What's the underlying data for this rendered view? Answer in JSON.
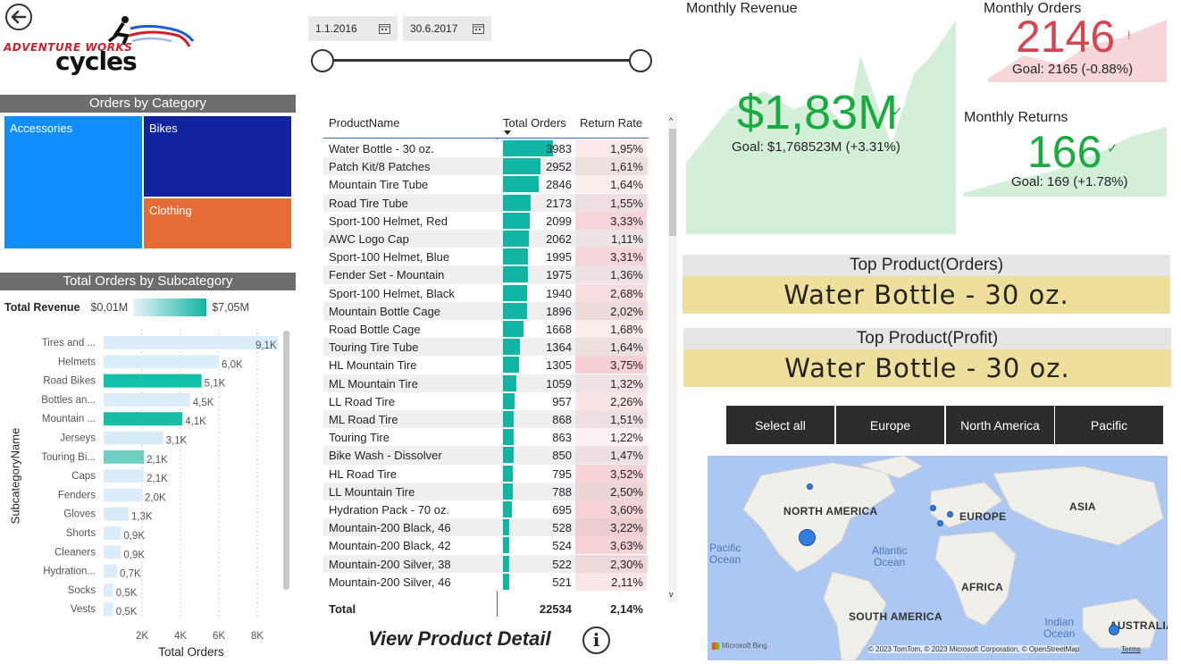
{
  "logo": {
    "line1": "ADVENTURE WORKS",
    "line2": "cycles"
  },
  "dates": {
    "start": "1.1.2016",
    "end": "30.6.2017"
  },
  "treemap": {
    "title": "Orders by Category",
    "items": [
      {
        "label": "Accessories",
        "color": "#118dff"
      },
      {
        "label": "Bikes",
        "color": "#12239e"
      },
      {
        "label": "Clothing",
        "color": "#e66c37"
      }
    ]
  },
  "subcategory": {
    "title": "Total Orders by Subcategory",
    "legend_label": "Total Revenue",
    "legend_min": "$0,01M",
    "legend_max": "$7,05M",
    "ylabel": "SubcategoryName",
    "xlabel": "Total Orders",
    "ticks": [
      "2K",
      "4K",
      "6K",
      "8K"
    ],
    "rows": [
      {
        "name": "Tires and ...",
        "value": 9.1,
        "label": "9,1K",
        "color": "#dbedfb"
      },
      {
        "name": "Helmets",
        "value": 6.0,
        "label": "6,0K",
        "color": "#d8eefa"
      },
      {
        "name": "Road Bikes",
        "value": 5.1,
        "label": "5,1K",
        "color": "#13c0a8"
      },
      {
        "name": "Bottles an...",
        "value": 4.5,
        "label": "4,5K",
        "color": "#dcedfa"
      },
      {
        "name": "Mountain ...",
        "value": 4.1,
        "label": "4,1K",
        "color": "#17bda5"
      },
      {
        "name": "Jerseys",
        "value": 3.1,
        "label": "3,1K",
        "color": "#d8ecf8"
      },
      {
        "name": "Touring Bi...",
        "value": 2.1,
        "label": "2,1K",
        "color": "#6dd0c2"
      },
      {
        "name": "Caps",
        "value": 2.1,
        "label": "2,1K",
        "color": "#dbedfb"
      },
      {
        "name": "Fenders",
        "value": 2.0,
        "label": "2,0K",
        "color": "#dbedfb"
      },
      {
        "name": "Gloves",
        "value": 1.3,
        "label": "1,3K",
        "color": "#d8ecf8"
      },
      {
        "name": "Shorts",
        "value": 0.9,
        "label": "0,9K",
        "color": "#dbedfb"
      },
      {
        "name": "Cleaners",
        "value": 0.9,
        "label": "0,9K",
        "color": "#dbedfb"
      },
      {
        "name": "Hydration...",
        "value": 0.7,
        "label": "0,7K",
        "color": "#dbedfb"
      },
      {
        "name": "Socks",
        "value": 0.5,
        "label": "0,5K",
        "color": "#dbedfb"
      },
      {
        "name": "Vests",
        "value": 0.5,
        "label": "0,5K",
        "color": "#dbedfb"
      }
    ]
  },
  "table": {
    "headers": [
      "ProductName",
      "Total Orders",
      "Return Rate"
    ],
    "rows": [
      {
        "name": "Water Bottle - 30 oz.",
        "orders": 3983,
        "orders_label": "3983",
        "rate": "1,95%"
      },
      {
        "name": "Patch Kit/8 Patches",
        "orders": 2952,
        "orders_label": "2952",
        "rate": "1,61%"
      },
      {
        "name": "Mountain Tire Tube",
        "orders": 2846,
        "orders_label": "2846",
        "rate": "1,64%"
      },
      {
        "name": "Road Tire Tube",
        "orders": 2173,
        "orders_label": "2173",
        "rate": "1,55%"
      },
      {
        "name": "Sport-100 Helmet, Red",
        "orders": 2099,
        "orders_label": "2099",
        "rate": "3,33%"
      },
      {
        "name": "AWC Logo Cap",
        "orders": 2062,
        "orders_label": "2062",
        "rate": "1,11%"
      },
      {
        "name": "Sport-100 Helmet, Blue",
        "orders": 1995,
        "orders_label": "1995",
        "rate": "3,31%"
      },
      {
        "name": "Fender Set - Mountain",
        "orders": 1975,
        "orders_label": "1975",
        "rate": "1,36%"
      },
      {
        "name": "Sport-100 Helmet, Black",
        "orders": 1940,
        "orders_label": "1940",
        "rate": "2,68%"
      },
      {
        "name": "Mountain Bottle Cage",
        "orders": 1896,
        "orders_label": "1896",
        "rate": "2,02%"
      },
      {
        "name": "Road Bottle Cage",
        "orders": 1668,
        "orders_label": "1668",
        "rate": "1,68%"
      },
      {
        "name": "Touring Tire Tube",
        "orders": 1364,
        "orders_label": "1364",
        "rate": "1,64%"
      },
      {
        "name": "HL Mountain Tire",
        "orders": 1305,
        "orders_label": "1305",
        "rate": "3,75%"
      },
      {
        "name": "ML Mountain Tire",
        "orders": 1059,
        "orders_label": "1059",
        "rate": "1,32%"
      },
      {
        "name": "LL Road Tire",
        "orders": 957,
        "orders_label": "957",
        "rate": "2,26%"
      },
      {
        "name": "ML Road Tire",
        "orders": 868,
        "orders_label": "868",
        "rate": "1,51%"
      },
      {
        "name": "Touring Tire",
        "orders": 863,
        "orders_label": "863",
        "rate": "1,22%"
      },
      {
        "name": "Bike Wash - Dissolver",
        "orders": 850,
        "orders_label": "850",
        "rate": "1,47%"
      },
      {
        "name": "HL Road Tire",
        "orders": 795,
        "orders_label": "795",
        "rate": "3,52%"
      },
      {
        "name": "LL Mountain Tire",
        "orders": 788,
        "orders_label": "788",
        "rate": "2,50%"
      },
      {
        "name": "Hydration Pack - 70 oz.",
        "orders": 695,
        "orders_label": "695",
        "rate": "3,60%"
      },
      {
        "name": "Mountain-200 Black, 46",
        "orders": 528,
        "orders_label": "528",
        "rate": "3,22%"
      },
      {
        "name": "Mountain-200 Black, 42",
        "orders": 524,
        "orders_label": "524",
        "rate": "3,63%"
      },
      {
        "name": "Mountain-200 Silver, 38",
        "orders": 522,
        "orders_label": "522",
        "rate": "2,30%"
      },
      {
        "name": "Mountain-200 Silver, 46",
        "orders": 521,
        "orders_label": "521",
        "rate": "2,11%"
      }
    ],
    "total_label": "Total",
    "total_orders": "22534",
    "total_rate": "2,14%"
  },
  "view_detail": "View Product Detail",
  "kpis": {
    "revenue": {
      "title": "Monthly Revenue",
      "value": "$1,83M",
      "goal": "Goal: $1,768523M (+3.31%)",
      "color": "#1aab40"
    },
    "orders": {
      "title": "Monthly Orders",
      "value": "2146",
      "goal": "Goal: 2165 (-0.88%)",
      "color": "#d64550"
    },
    "returns": {
      "title": "Monthly Returns",
      "value": "166",
      "goal": "Goal: 169 (+1.78%)",
      "color": "#1aab40"
    }
  },
  "top_orders": {
    "title": "Top Product(Orders)",
    "value": "Water Bottle - 30 oz."
  },
  "top_profit": {
    "title": "Top Product(Profit)",
    "value": "Water Bottle - 30 oz."
  },
  "regions": [
    "Select all",
    "Europe",
    "North America",
    "Pacific"
  ],
  "map": {
    "labels": [
      "NORTH AMERICA",
      "EUROPE",
      "ASIA",
      "AFRICA",
      "SOUTH AMERICA",
      "AUSTRALIA"
    ],
    "oceans": [
      "Pacific\nOcean",
      "Atlantic\nOcean",
      "Indian\nOcean"
    ],
    "brand": "Microsoft Bing",
    "copyright": "© 2023 TomTom, © 2023 Microsoft Corporation, © OpenStreetMap",
    "terms": "Terms"
  }
}
